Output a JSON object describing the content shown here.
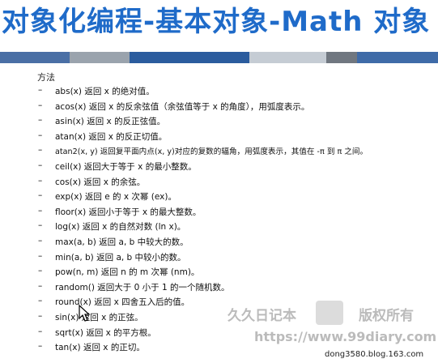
{
  "title": "对象化编程-基本对象-Math 对象",
  "section_label": "方法",
  "bullet": "–",
  "items": [
    "abs(x) 返回 x 的绝对值。",
    "acos(x) 返回 x 的反余弦值（余弦值等于 x 的角度），用弧度表示。",
    "asin(x) 返回 x 的反正弦值。",
    "atan(x) 返回 x 的反正切值。",
    "atan2(x, y) 返回复平面内点(x, y)对应的复数的辐角，用弧度表示，其值在 -π 到 π 之间。",
    "ceil(x) 返回大于等于 x 的最小整数。",
    "cos(x) 返回 x 的余弦。",
    "exp(x) 返回 e 的 x 次幂 (ex)。",
    "floor(x) 返回小于等于 x 的最大整数。",
    "log(x) 返回 x 的自然对数 (ln x)。",
    "max(a, b) 返回 a, b 中较大的数。",
    "min(a, b) 返回 a, b 中较小的数。",
    "pow(n, m) 返回 n 的 m 次幂 (nm)。",
    "random() 返回大于 0 小于 1 的一个随机数。",
    "round(x) 返回 x 四舍五入后的值。",
    "sin(x) 返回 x 的正弦。",
    "sqrt(x) 返回 x 的平方根。",
    "tan(x) 返回 x 的正切。"
  ],
  "watermark": {
    "left": "久久日记本",
    "right": "版权所有",
    "url": "https://www.99diary.com"
  },
  "credit": "dong3580.blog.163.com",
  "colors": {
    "title": "#1f6bc9"
  }
}
